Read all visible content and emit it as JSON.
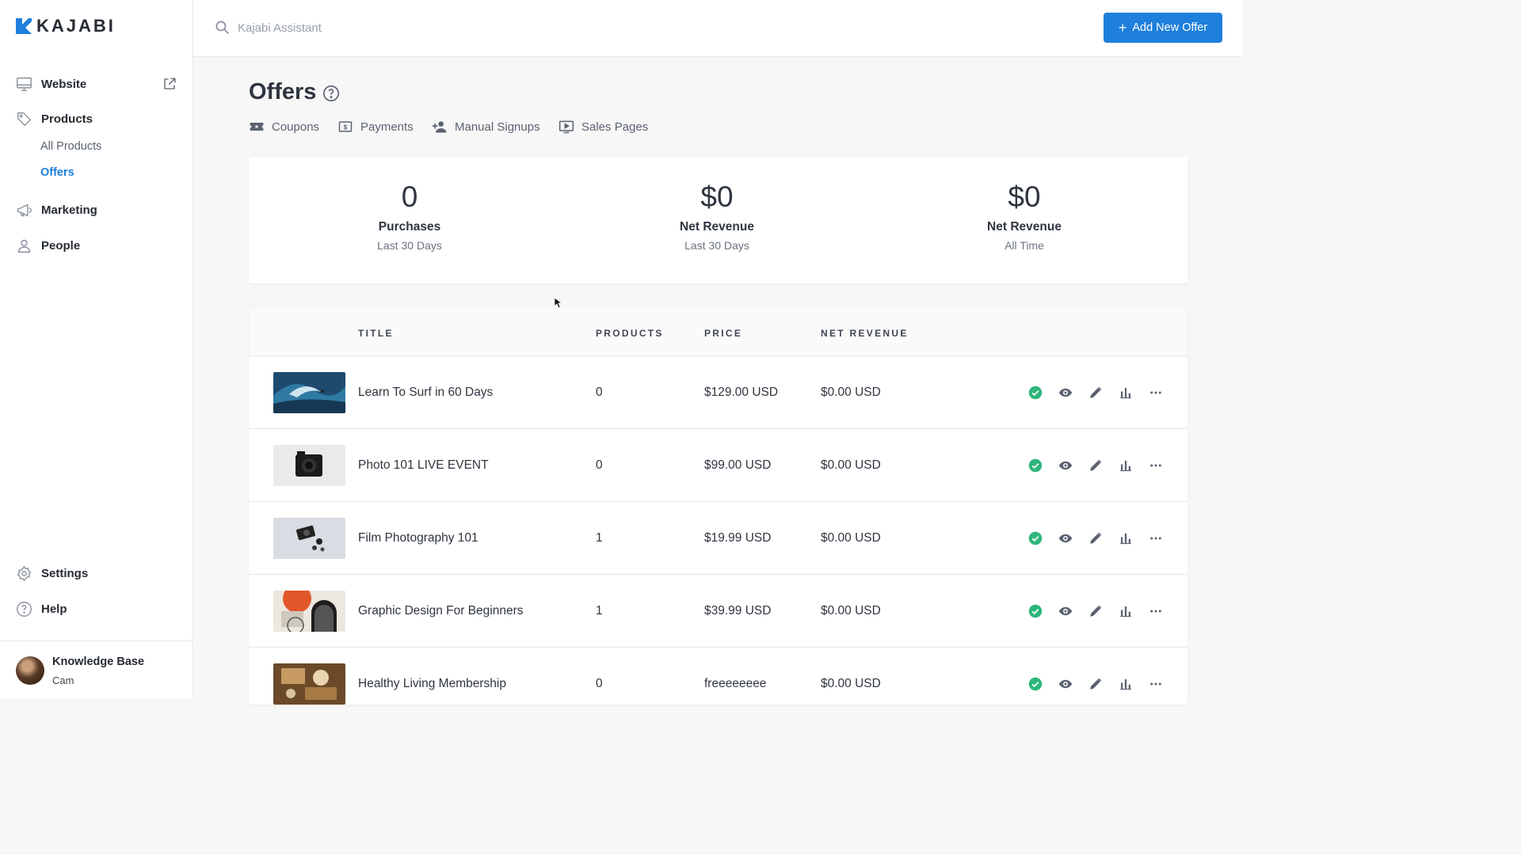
{
  "brand": {
    "name": "KAJABI",
    "accent": "#1e7fdc"
  },
  "sidebar": {
    "items": [
      {
        "label": "Website",
        "icon": "monitor-icon"
      },
      {
        "label": "Products",
        "icon": "tag-icon"
      },
      {
        "label": "Marketing",
        "icon": "megaphone-icon"
      },
      {
        "label": "People",
        "icon": "person-icon"
      }
    ],
    "product_subitems": [
      {
        "label": "All Products",
        "active": false
      },
      {
        "label": "Offers",
        "active": true
      }
    ],
    "bottom_items": [
      {
        "label": "Settings",
        "icon": "gear-icon"
      },
      {
        "label": "Help",
        "icon": "help-circle-icon"
      }
    ],
    "account": {
      "name": "Knowledge Base",
      "user": "Cam"
    }
  },
  "topbar": {
    "search_placeholder": "Kajabi Assistant",
    "add_button_label": "Add New Offer"
  },
  "page": {
    "title": "Offers",
    "subnav": [
      {
        "label": "Coupons",
        "icon": "ticket-icon"
      },
      {
        "label": "Payments",
        "icon": "dollar-bill-icon"
      },
      {
        "label": "Manual Signups",
        "icon": "add-person-icon"
      },
      {
        "label": "Sales Pages",
        "icon": "play-screen-icon"
      }
    ]
  },
  "stats": [
    {
      "value": "0",
      "label": "Purchases",
      "period": "Last 30 Days"
    },
    {
      "value": "$0",
      "label": "Net Revenue",
      "period": "Last 30 Days"
    },
    {
      "value": "$0",
      "label": "Net Revenue",
      "period": "All Time"
    }
  ],
  "table": {
    "columns": [
      "TITLE",
      "PRODUCTS",
      "PRICE",
      "NET REVENUE"
    ],
    "rows": [
      {
        "title": "Learn To Surf in 60 Days",
        "products": "0",
        "price": "$129.00 USD",
        "revenue": "$0.00 USD",
        "status": "published"
      },
      {
        "title": "Photo 101 LIVE EVENT",
        "products": "0",
        "price": "$99.00 USD",
        "revenue": "$0.00 USD",
        "status": "published"
      },
      {
        "title": "Film Photography 101",
        "products": "1",
        "price": "$19.99 USD",
        "revenue": "$0.00 USD",
        "status": "published"
      },
      {
        "title": "Graphic Design For Beginners",
        "products": "1",
        "price": "$39.99 USD",
        "revenue": "$0.00 USD",
        "status": "published"
      },
      {
        "title": "Healthy Living Membership",
        "products": "0",
        "price": "freeeeeeee",
        "revenue": "$0.00 USD",
        "status": "published"
      }
    ],
    "row_actions": [
      "check-circle-icon",
      "eye-icon",
      "pencil-icon",
      "bar-chart-icon",
      "more-icon"
    ]
  }
}
